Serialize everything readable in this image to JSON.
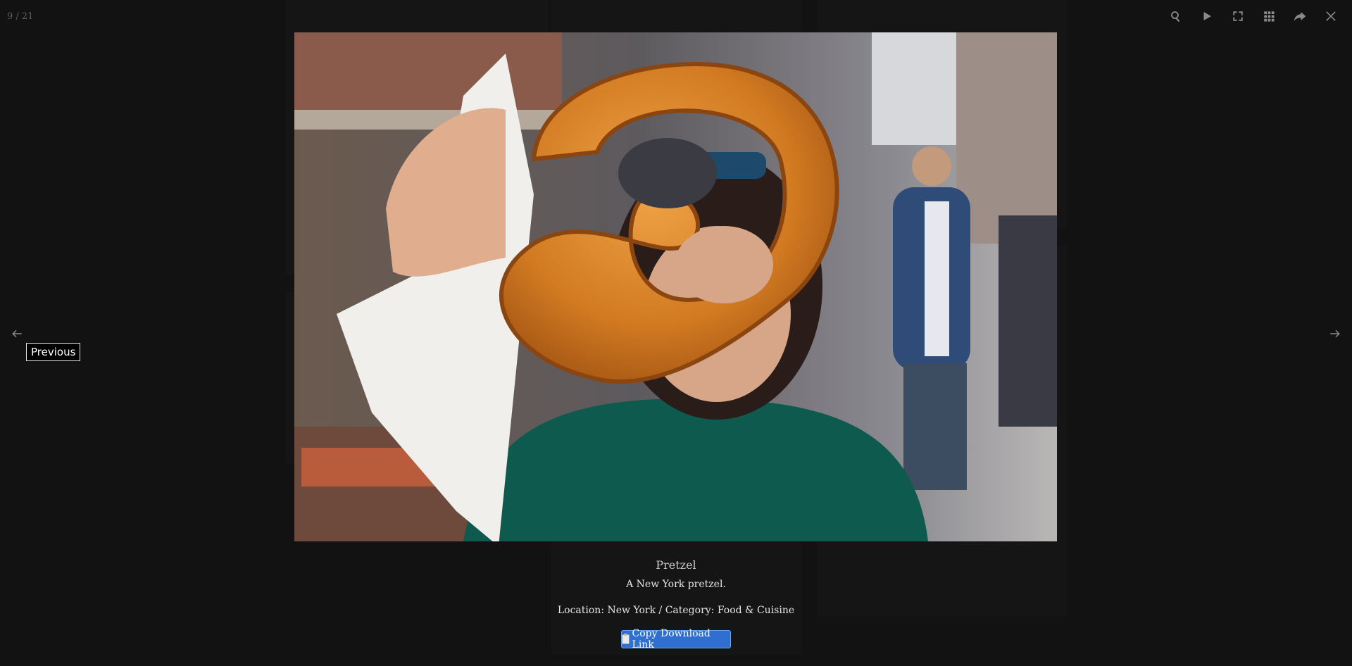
{
  "viewer": {
    "counter": "9 / 21",
    "tooltip": "Previous"
  },
  "toolbar": {
    "items": [
      {
        "name": "zoom",
        "icon": "magnifier-icon"
      },
      {
        "name": "slideshow",
        "icon": "play-icon"
      },
      {
        "name": "fullscreen",
        "icon": "fullscreen-icon"
      },
      {
        "name": "thumbnails",
        "icon": "grid-icon"
      },
      {
        "name": "share",
        "icon": "share-icon"
      },
      {
        "name": "close",
        "icon": "close-icon"
      }
    ]
  },
  "image": {
    "subject": "pretzel"
  },
  "caption": {
    "title": "Pretzel",
    "description": "A New York pretzel.",
    "meta": "Location: New York / Category: Food & Cuisine",
    "button_label": "Copy Download Link"
  },
  "colors": {
    "backdrop": "#121212",
    "button": "#2f6fd0",
    "icon": "#8a8a8a"
  }
}
